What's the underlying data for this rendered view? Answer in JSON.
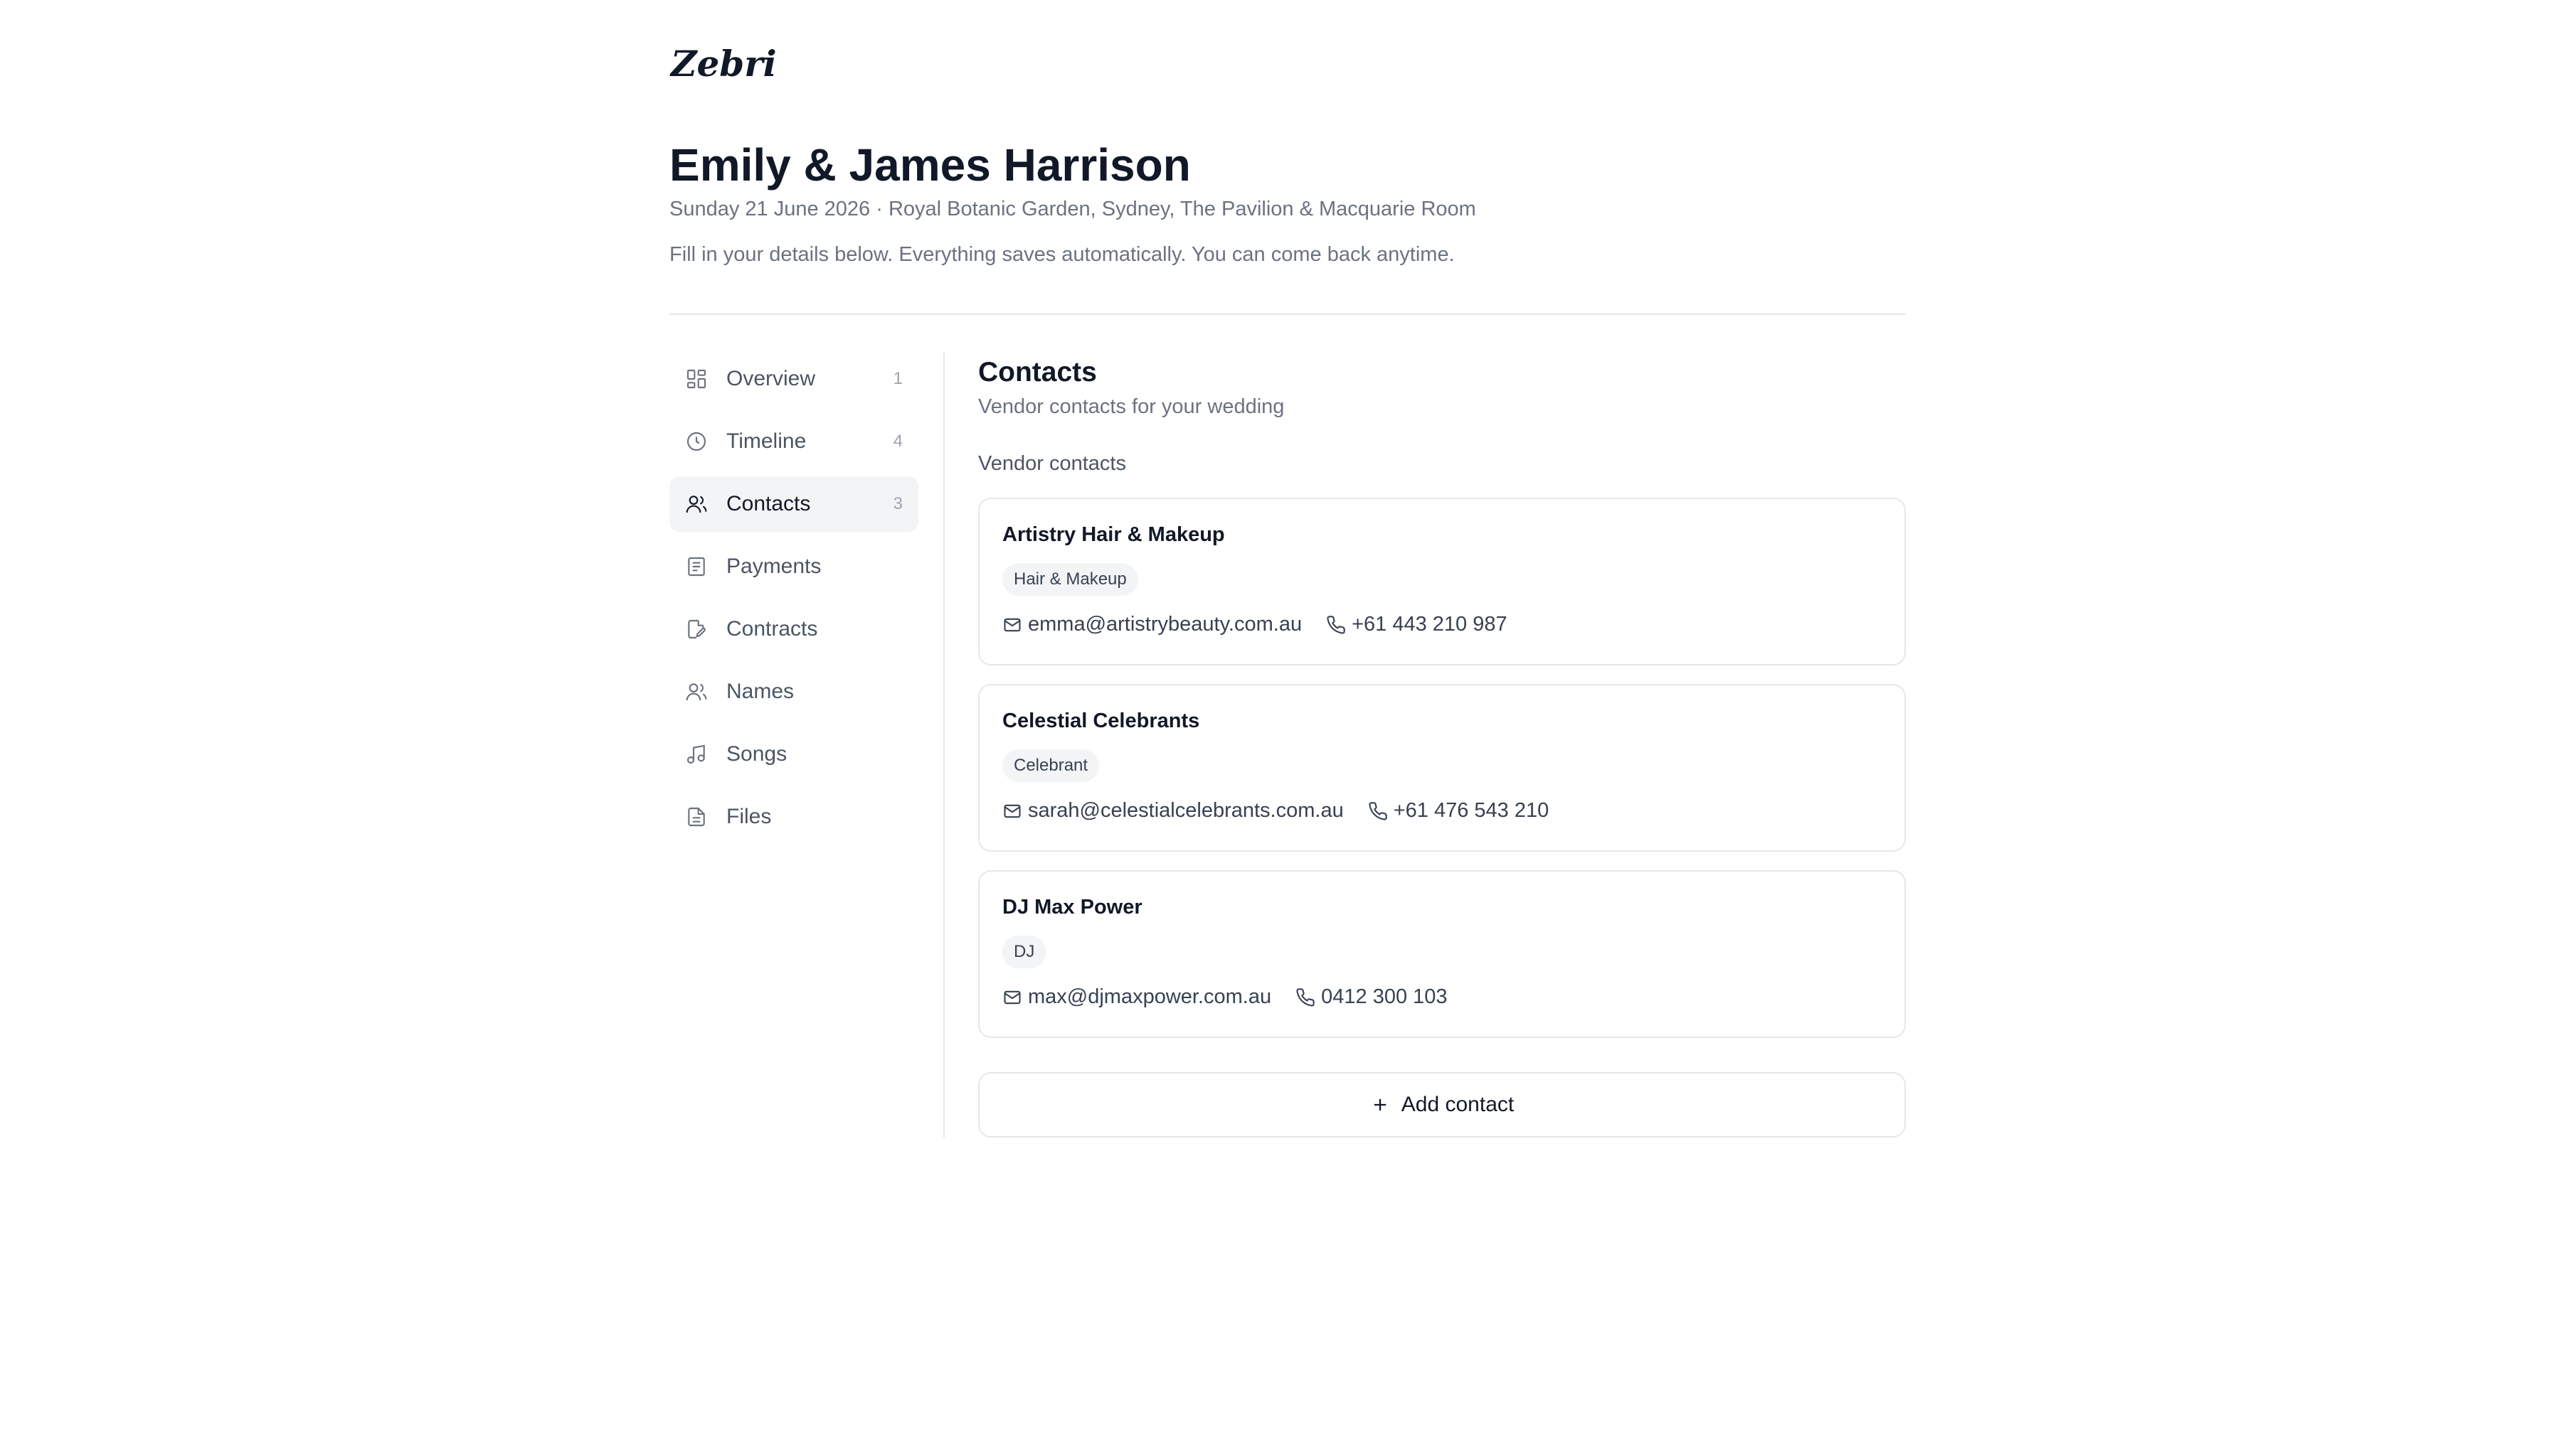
{
  "brand": {
    "logo_text": "Zebri"
  },
  "header": {
    "couple": "Emily & James Harrison",
    "event_line": "Sunday 21 June 2026 · Royal Botanic Garden, Sydney, The Pavilion & Macquarie Room",
    "instructions": "Fill in your details below. Everything saves automatically. You can come back anytime."
  },
  "sidebar": {
    "items": [
      {
        "label": "Overview",
        "count": "1",
        "icon": "grid-icon",
        "active": false
      },
      {
        "label": "Timeline",
        "count": "4",
        "icon": "clock-icon",
        "active": false
      },
      {
        "label": "Contacts",
        "count": "3",
        "icon": "users-icon",
        "active": true
      },
      {
        "label": "Payments",
        "count": "",
        "icon": "receipt-icon",
        "active": false
      },
      {
        "label": "Contracts",
        "count": "",
        "icon": "file-signature-icon",
        "active": false
      },
      {
        "label": "Names",
        "count": "",
        "icon": "people-icon",
        "active": false
      },
      {
        "label": "Songs",
        "count": "",
        "icon": "music-icon",
        "active": false
      },
      {
        "label": "Files",
        "count": "",
        "icon": "file-icon",
        "active": false
      }
    ]
  },
  "main": {
    "title": "Contacts",
    "subtitle": "Vendor contacts for your wedding",
    "group_label": "Vendor contacts",
    "contacts": [
      {
        "name": "Artistry Hair & Makeup",
        "tag": "Hair & Makeup",
        "email": "emma@artistrybeauty.com.au",
        "phone": "+61 443 210 987"
      },
      {
        "name": "Celestial Celebrants",
        "tag": "Celebrant",
        "email": "sarah@celestialcelebrants.com.au",
        "phone": "+61 476 543 210"
      },
      {
        "name": "DJ Max Power",
        "tag": "DJ",
        "email": "max@djmaxpower.com.au",
        "phone": "0412 300 103"
      }
    ],
    "add_contact_label": "Add contact"
  },
  "colors": {
    "text_primary": "#111827",
    "text_muted": "#6b7280",
    "border": "#e5e7eb",
    "active_bg": "#f3f4f6"
  }
}
